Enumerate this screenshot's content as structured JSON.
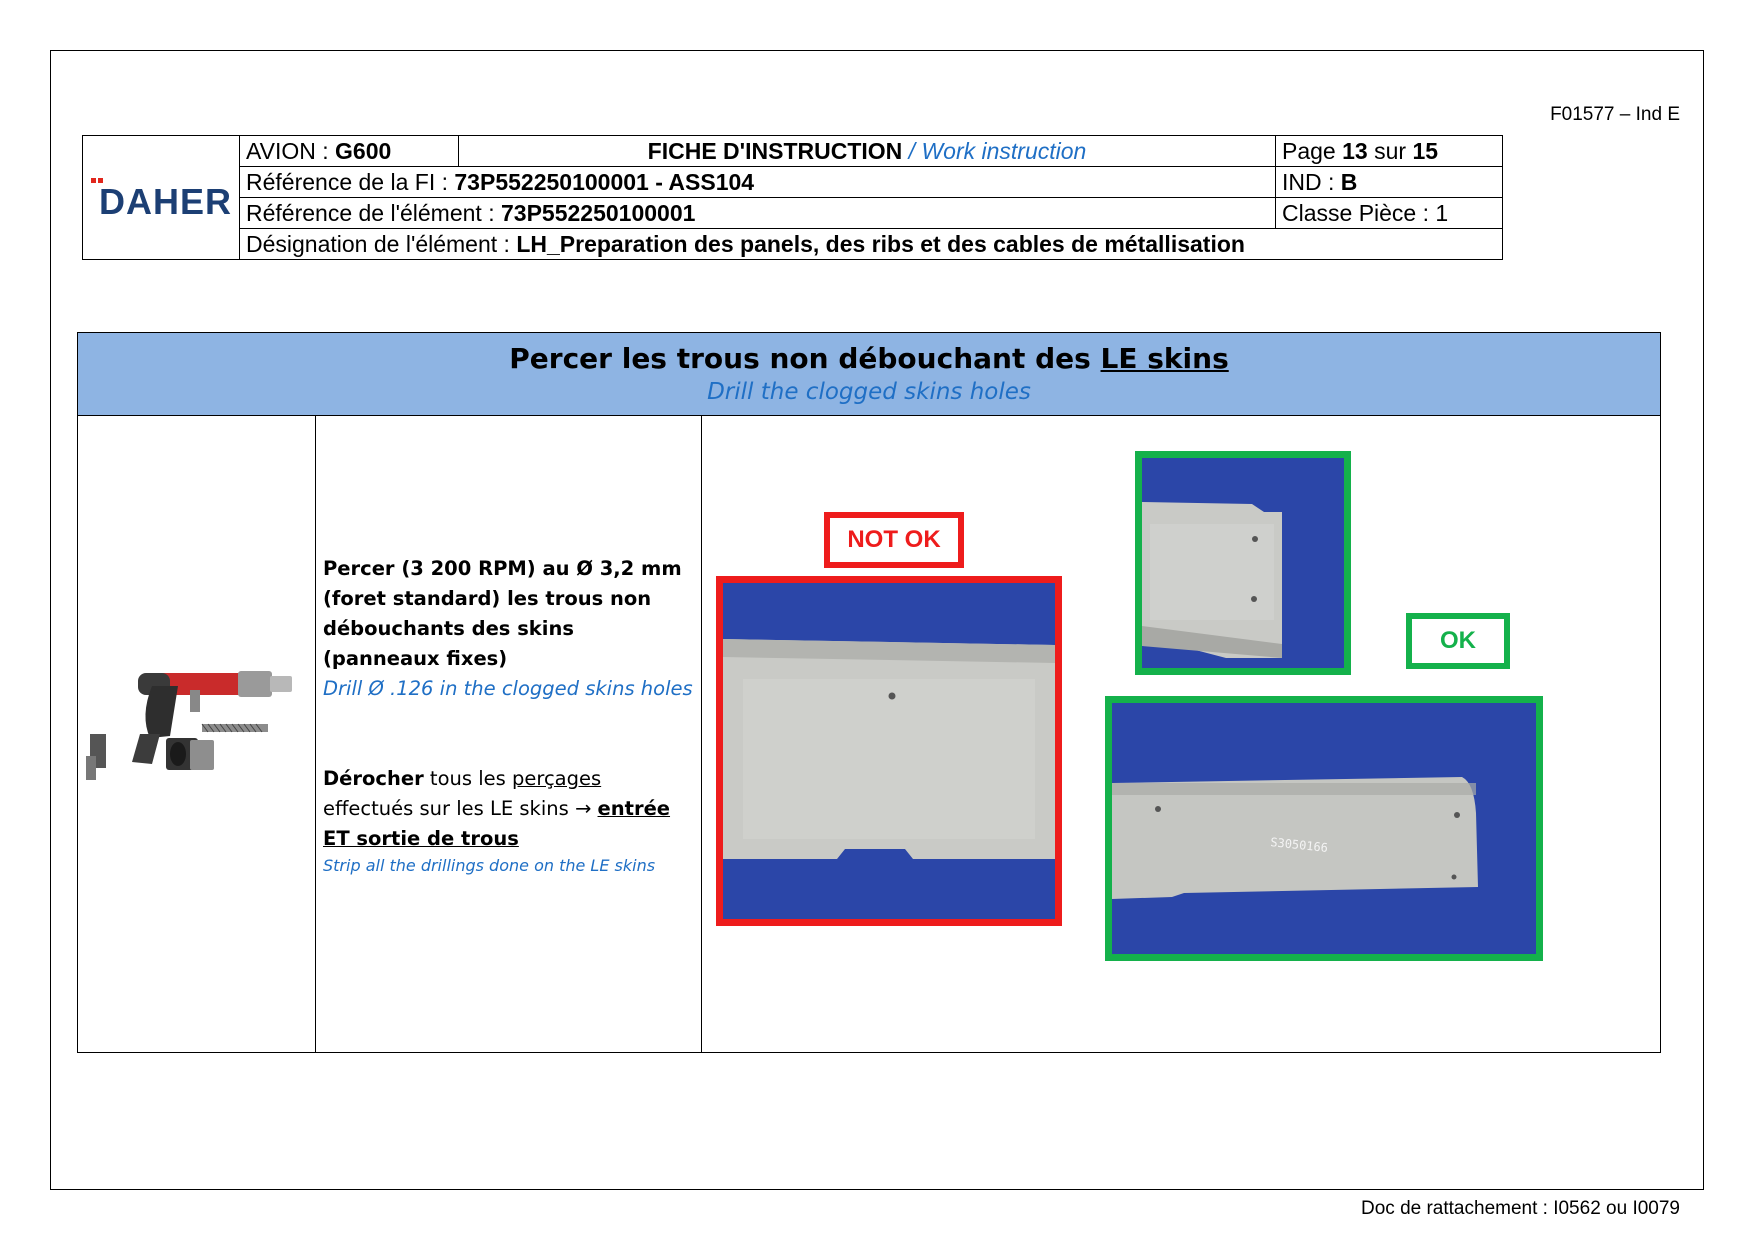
{
  "form_ref": "F01577 – Ind E",
  "header": {
    "logo_text": "DAHER",
    "avion_label": "AVION : ",
    "avion_value": "G600",
    "fiche_title": "FICHE D'INSTRUCTION",
    "fiche_sep": " / ",
    "fiche_subtitle": "Work instruction",
    "page_label": "Page ",
    "page_current": "13",
    "page_sep": " sur ",
    "page_total": "15",
    "ref_fi_label": "Référence de la FI : ",
    "ref_fi_value": "73P552250100001 - ASS104",
    "ind_label": "IND : ",
    "ind_value": "B",
    "ref_elem_label": "Référence de l'élément : ",
    "ref_elem_value": "73P552250100001",
    "classe_label": "Classe Pièce : 1",
    "desig_label": "Désignation de l'élément : ",
    "desig_value": "LH_Preparation des panels, des ribs et des cables de métallisation"
  },
  "instruction": {
    "title_pre": "Percer les trous non débouchant des ",
    "title_underlined": "LE skins",
    "subtitle": "Drill the clogged skins holes",
    "text": {
      "p1_bold": "Percer (3 200 RPM) au Ø 3,2 mm (foret standard) les trous non débouchants des skins (panneaux fixes)",
      "p1_en": "Drill Ø .126 in the clogged skins holes",
      "p2_bold": "Dérocher",
      "p2_a": " tous les ",
      "p2_u": "perçages",
      "p2_b": " effectués sur les LE skins → ",
      "p2_bu": "entrée ET sortie de trous",
      "p2_en": "Strip all the drillings done on the LE skins"
    },
    "tags": {
      "not_ok": "NOT OK",
      "ok": "OK"
    },
    "photo_marking": "S3050166"
  },
  "footer": "Doc de rattachement : I0562 ou I0079",
  "colors": {
    "header_blue": "#8eb4e3",
    "text_blue": "#1f6fc5",
    "not_ok_red": "#ee1c1c",
    "ok_green": "#14b14b",
    "logo_navy": "#1c3f74"
  }
}
